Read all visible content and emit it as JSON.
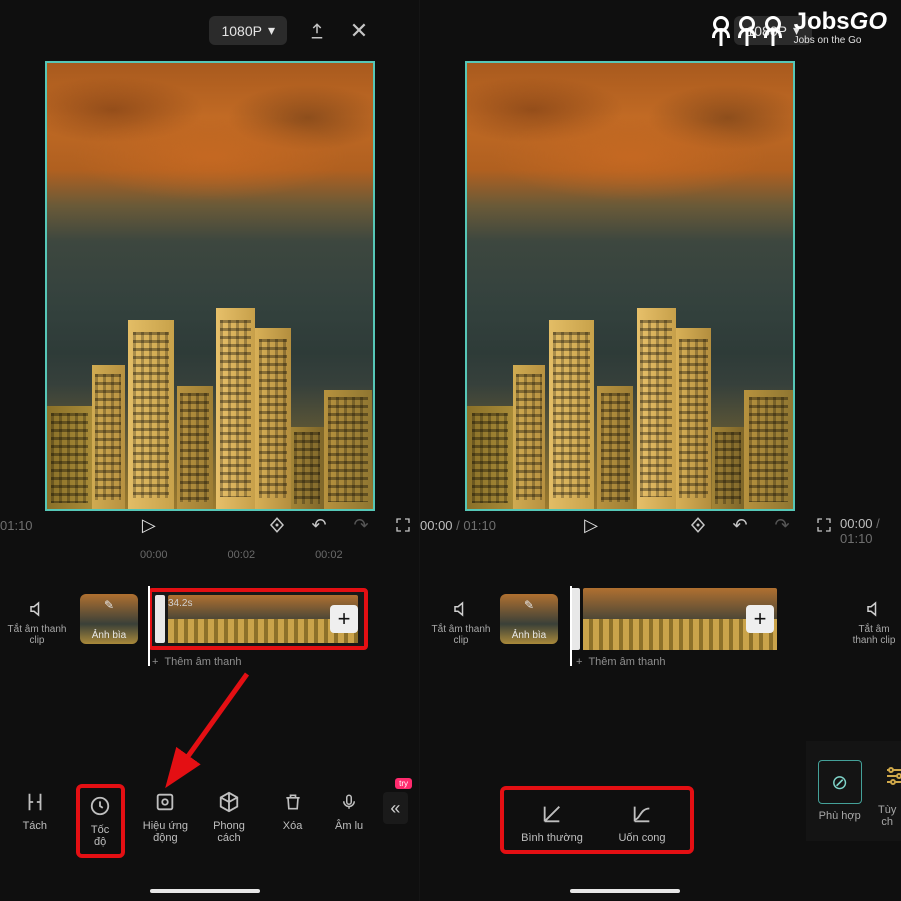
{
  "topbar": {
    "resolution": "1080P"
  },
  "transport": {
    "current_time": "00:00",
    "total_time": "01:10"
  },
  "ruler": {
    "t0": "00:00",
    "t1": "00:02",
    "t2": "00:02"
  },
  "tracks": {
    "mute_clip_label": "Tắt âm thanh clip",
    "cover_label": "Ảnh bìa",
    "clip_duration": "34.2s",
    "add_audio_label": "Thêm âm thanh"
  },
  "tools_left": {
    "split": "Tách",
    "speed": "Tốc độ",
    "effect": "Hiệu ứng động",
    "style": "Phong cách",
    "try_badge": "try",
    "delete": "Xóa",
    "record": "Âm lu"
  },
  "tools_right": {
    "normal": "Bình thường",
    "curve": "Uốn cong"
  },
  "fit_panel": {
    "fit": "Phù hợp",
    "custom": "Tùy ch"
  },
  "logo": {
    "brand": "JobsGO",
    "tagline": "Jobs on the Go"
  }
}
